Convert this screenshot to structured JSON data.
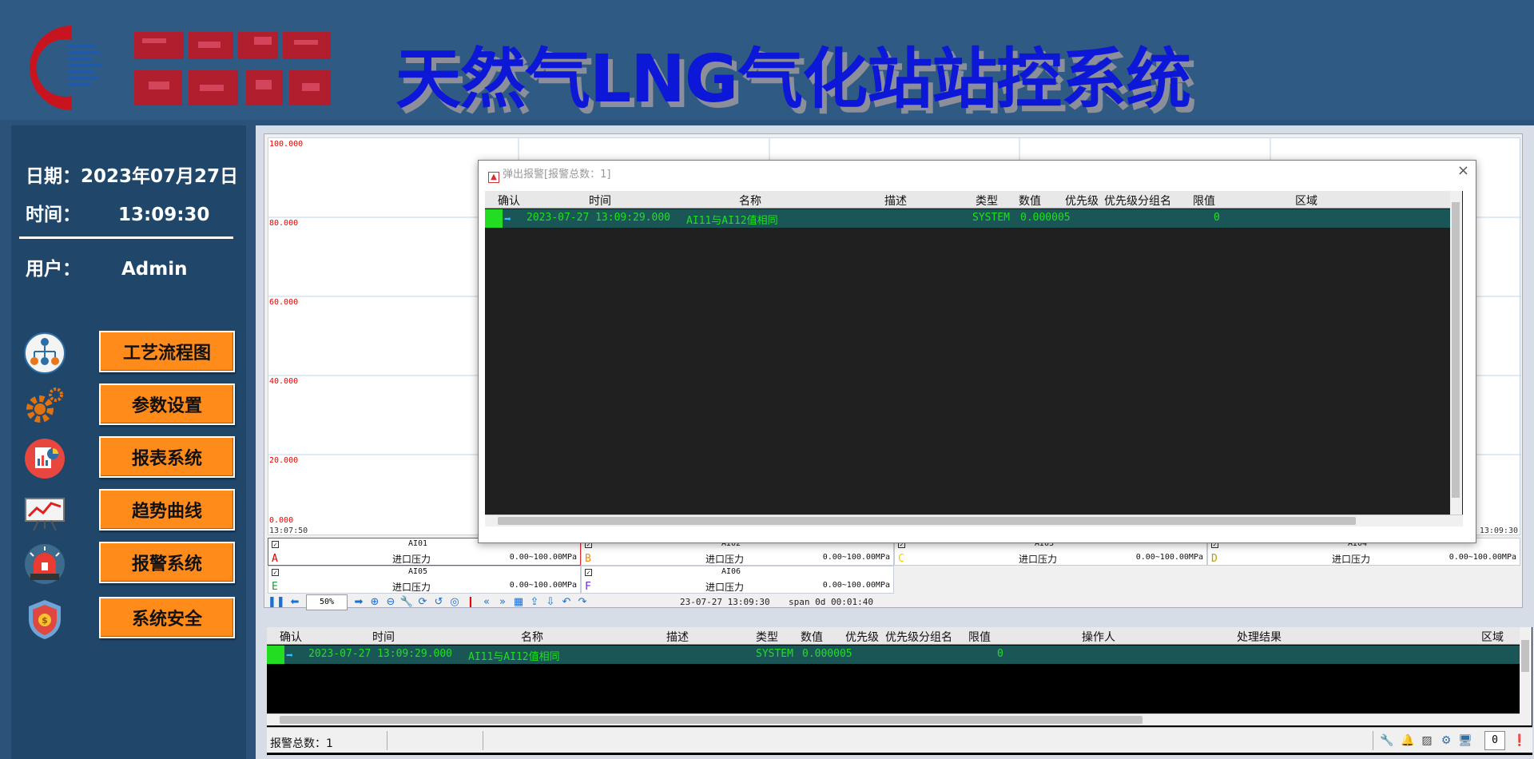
{
  "header": {
    "title": "天然气LNG气化站站控系统",
    "logo_alt": "company-logo"
  },
  "sidebar": {
    "date_label": "日期：",
    "date_value": "2023年07月27日",
    "time_label": "时间：",
    "time_value": "13:09:30",
    "user_label": "用户：",
    "user_value": "Admin",
    "nav": [
      {
        "label": "工艺流程图",
        "icon": "process-flow-icon"
      },
      {
        "label": "参数设置",
        "icon": "gear-icon"
      },
      {
        "label": "报表系统",
        "icon": "report-icon"
      },
      {
        "label": "趋势曲线",
        "icon": "trend-chart-icon"
      },
      {
        "label": "报警系统",
        "icon": "alarm-light-icon"
      },
      {
        "label": "系统安全",
        "icon": "security-shield-icon"
      }
    ],
    "colors": {
      "button": "#ff8b1a",
      "panel": "#20466a"
    }
  },
  "trend": {
    "y_ticks": [
      "100.000",
      "80.000",
      "60.000",
      "40.000",
      "20.000",
      "0.000"
    ],
    "x_start": "13:07:50",
    "x_end": "13:09:30",
    "legend": [
      {
        "check": "✓",
        "tag": "AI01",
        "letter": "A",
        "name": "进口压力",
        "range": "0.00~100.00MPa",
        "color": "#e00000"
      },
      {
        "check": "✓",
        "tag": "AI02",
        "letter": "B",
        "name": "进口压力",
        "range": "0.00~100.00MPa",
        "color": "#ff8800"
      },
      {
        "check": "✓",
        "tag": "AI03",
        "letter": "C",
        "name": "进口压力",
        "range": "0.00~100.00MPa",
        "color": "#e6d600"
      },
      {
        "check": "✓",
        "tag": "AI04",
        "letter": "D",
        "name": "进口压力",
        "range": "0.00~100.00MPa",
        "color": "#b8a000"
      },
      {
        "check": "✓",
        "tag": "AI05",
        "letter": "E",
        "name": "进口压力",
        "range": "0.00~100.00MPa",
        "color": "#1a9a3a"
      },
      {
        "check": "✓",
        "tag": "AI06",
        "letter": "F",
        "name": "进口压力",
        "range": "0.00~100.00MPa",
        "color": "#6a2ad0"
      }
    ],
    "toolbar": {
      "zoom": "50%",
      "timestamp": "23-07-27 13:09:30",
      "span": "span 0d 00:01:40"
    }
  },
  "popup": {
    "title": "弹出报警[报警总数：1]",
    "close": "×",
    "columns": [
      "确认",
      "时间",
      "名称",
      "描述",
      "类型",
      "数值",
      "优先级",
      "优先级分组名",
      "限值",
      "区域"
    ],
    "rows": [
      {
        "time": "2023-07-27 13:09:29.000",
        "name": "AI11与AI12值相同",
        "type": "SYSTEM",
        "value": "0.000005",
        "limit": "0"
      }
    ]
  },
  "alarm_table": {
    "columns": [
      "确认",
      "时间",
      "名称",
      "描述",
      "类型",
      "数值",
      "优先级",
      "优先级分组名",
      "限值",
      "操作人",
      "处理结果",
      "区域"
    ],
    "rows": [
      {
        "time": "2023-07-27 13:09:29.000",
        "name": "AI11与AI12值相同",
        "type": "SYSTEM",
        "value": "0.000005",
        "limit": "0"
      }
    ],
    "status_text": "报警总数：1",
    "count_box": "0"
  }
}
